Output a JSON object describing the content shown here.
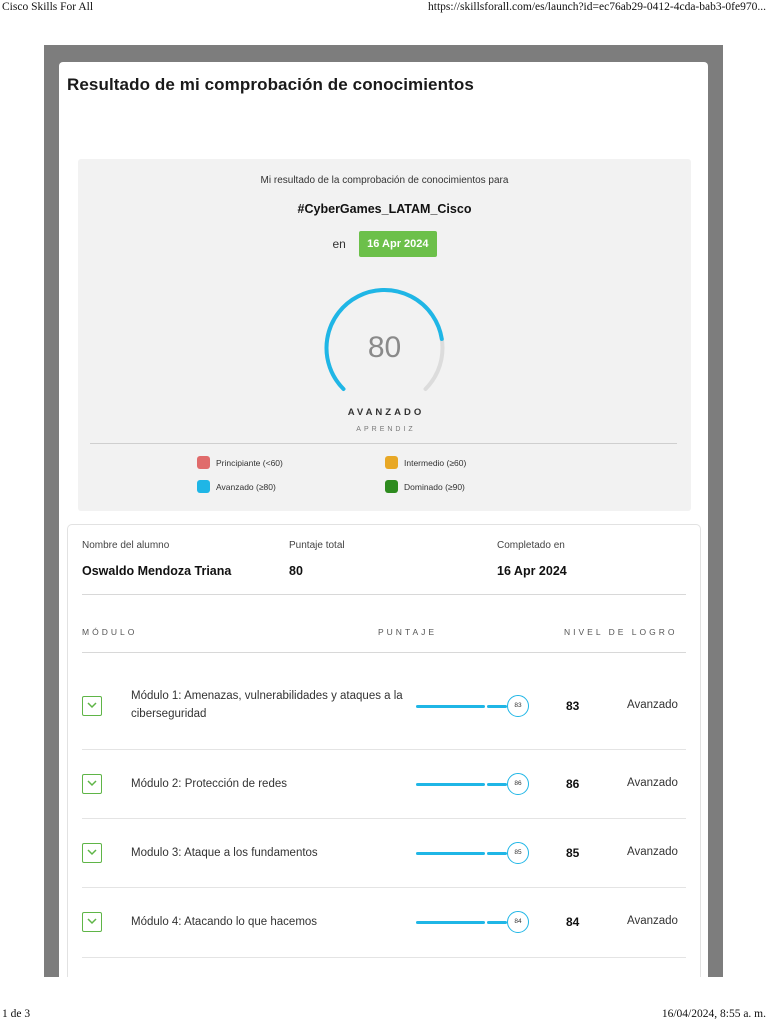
{
  "browser": {
    "page_title": "Cisco Skills For All",
    "url": "https://skillsforall.com/es/launch?id=ec76ab29-0412-4cda-bab3-0fe970..."
  },
  "footer": {
    "page_count": "1 de 3",
    "datetime": "16/04/2024, 8:55 a. m."
  },
  "page": {
    "title": "Resultado de mi comprobación de conocimientos"
  },
  "summary": {
    "intro": "Mi resultado de la comprobación de conocimientos para",
    "course": "#CyberGames_LATAM_Cisco",
    "date_prefix": "en",
    "date": "16 Apr 2024",
    "score": "80",
    "score_fraction": 0.8,
    "level": "AVANZADO",
    "sublevel": "APRENDIZ",
    "gauge_color": "#1fb6e6",
    "legend": [
      {
        "label": "Principiante (<60)",
        "color": "#e06b6b"
      },
      {
        "label": "Intermedio (≥60)",
        "color": "#e8a826"
      },
      {
        "label": "Avanzado (≥80)",
        "color": "#1fb6e6"
      },
      {
        "label": "Dominado (≥90)",
        "color": "#2e8b1f"
      }
    ]
  },
  "results": {
    "student_label": "Nombre del alumno",
    "student_name": "Oswaldo Mendoza Triana",
    "total_label": "Puntaje total",
    "total_value": "80",
    "completed_label": "Completado en",
    "completed_value": "16 Apr 2024",
    "col_module": "MÓDULO",
    "col_score": "PUNTAJE",
    "col_level": "NIVEL DE LOGRO",
    "modules": [
      {
        "name": "Módulo 1: Amenazas, vulnerabilidades y ataques a la ciberseguridad",
        "score": "83",
        "level": "Avanzado"
      },
      {
        "name": "Módulo 2: Protección de redes",
        "score": "86",
        "level": "Avanzado"
      },
      {
        "name": "Modulo 3: Ataque a los fundamentos",
        "score": "85",
        "level": "Avanzado"
      },
      {
        "name": "Módulo 4: Atacando lo que hacemos",
        "score": "84",
        "level": "Avanzado"
      }
    ]
  }
}
